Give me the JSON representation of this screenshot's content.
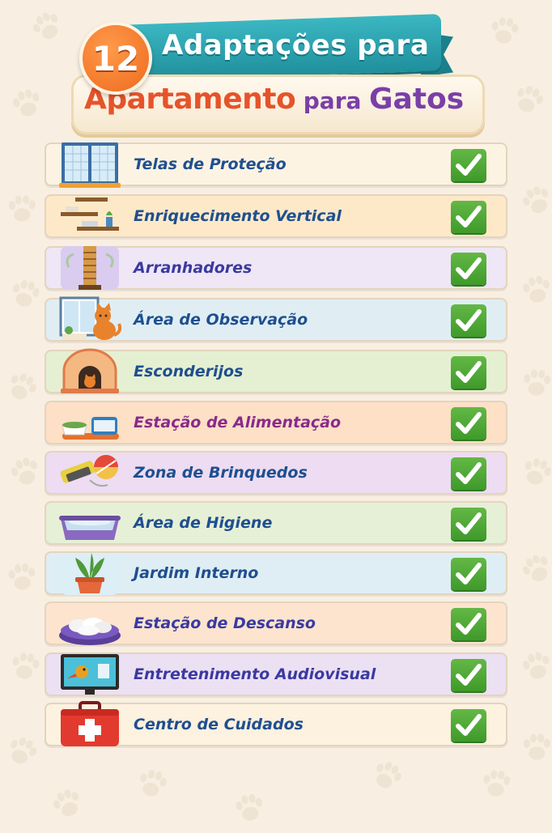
{
  "header": {
    "number": "12",
    "title_line1": "Adaptações para",
    "title_main": "Apartamento",
    "title_connector": "para",
    "title_end": "Gatos"
  },
  "colors": {
    "background": "#f8efe2",
    "banner": "#2aa3b0",
    "badge": "#f07a2a",
    "title_orange": "#e6532a",
    "title_purple": "#7a3fa8",
    "check_green": "#4caf34"
  },
  "items": [
    {
      "label": "Telas de Proteção",
      "icon": "window-screen-icon",
      "checked": true,
      "bg": "#fdf3e3",
      "text_color": "#1f4f8f"
    },
    {
      "label": "Enriquecimento Vertical",
      "icon": "wall-shelves-icon",
      "checked": true,
      "bg": "#fde9c8",
      "text_color": "#1f4f8f"
    },
    {
      "label": "Arranhadores",
      "icon": "scratching-post-icon",
      "checked": true,
      "bg": "#efe6f6",
      "text_color": "#3a3aa0"
    },
    {
      "label": "Área de Observação",
      "icon": "window-cat-icon",
      "checked": true,
      "bg": "#e0eef4",
      "text_color": "#1f4f8f"
    },
    {
      "label": "Esconderijos",
      "icon": "cat-hideout-icon",
      "checked": true,
      "bg": "#e5f0d2",
      "text_color": "#1f4f8f"
    },
    {
      "label": "Estação de Alimentação",
      "icon": "food-bowls-icon",
      "checked": true,
      "bg": "#fde0c6",
      "text_color": "#8a2a8a"
    },
    {
      "label": "Zona de Brinquedos",
      "icon": "toys-icon",
      "checked": true,
      "bg": "#eddcf2",
      "text_color": "#1f4f8f"
    },
    {
      "label": "Área de Higiene",
      "icon": "litter-box-icon",
      "checked": true,
      "bg": "#e6f0d6",
      "text_color": "#1f4f8f"
    },
    {
      "label": "Jardim Interno",
      "icon": "potted-plant-icon",
      "checked": true,
      "bg": "#dfeef4",
      "text_color": "#1f4f8f"
    },
    {
      "label": "Estação de Descanso",
      "icon": "cat-bed-icon",
      "checked": true,
      "bg": "#fde4cf",
      "text_color": "#3a3aa0"
    },
    {
      "label": "Entretenimento Audiovisual",
      "icon": "tv-bird-icon",
      "checked": true,
      "bg": "#ece0f3",
      "text_color": "#3a3aa0"
    },
    {
      "label": "Centro de Cuidados",
      "icon": "first-aid-kit-icon",
      "checked": true,
      "bg": "#fdf1df",
      "text_color": "#1f4f8f"
    }
  ]
}
